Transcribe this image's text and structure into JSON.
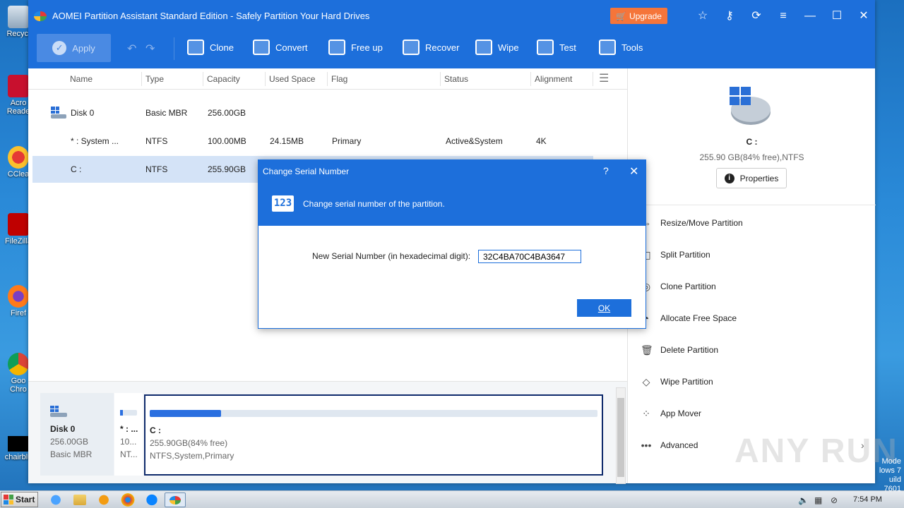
{
  "desktop": {
    "icons": [
      {
        "label": "Recycl"
      },
      {
        "label": "Acro Reade"
      },
      {
        "label": "CClea"
      },
      {
        "label": "FileZilla"
      },
      {
        "label": "Firef"
      },
      {
        "label": "Goo Chro"
      },
      {
        "label": "chairblu"
      }
    ],
    "win_mode": [
      "Mode",
      "lows 7",
      "uild 7601"
    ]
  },
  "app": {
    "title": "AOMEI Partition Assistant Standard Edition - Safely Partition Your Hard Drives",
    "upgrade_label": "Upgrade",
    "apply_label": "Apply",
    "tools": [
      {
        "label": "Clone"
      },
      {
        "label": "Convert"
      },
      {
        "label": "Free up"
      },
      {
        "label": "Recover"
      },
      {
        "label": "Wipe"
      },
      {
        "label": "Test"
      },
      {
        "label": "Tools"
      }
    ]
  },
  "table": {
    "columns": [
      "Name",
      "Type",
      "Capacity",
      "Used Space",
      "Flag",
      "Status",
      "Alignment"
    ],
    "rows": [
      {
        "name": "Disk 0",
        "type": "Basic MBR",
        "capacity": "256.00GB",
        "used": "",
        "flag": "",
        "status": "",
        "alignment": ""
      },
      {
        "name": "* : System ...",
        "type": "NTFS",
        "capacity": "100.00MB",
        "used": "24.15MB",
        "flag": "Primary",
        "status": "Active&System",
        "alignment": "4K"
      },
      {
        "name": "C :",
        "type": "NTFS",
        "capacity": "255.90GB",
        "used": "",
        "flag": "",
        "status": "",
        "alignment": ""
      }
    ]
  },
  "diskmap": {
    "disk_name": "Disk 0",
    "disk_size": "256.00GB",
    "disk_type": "Basic MBR",
    "small_name": "* : ...",
    "small_size": "10...",
    "small_fs": "NT...",
    "main_name": "C :",
    "main_size": "255.90GB(84% free)",
    "main_info": "NTFS,System,Primary",
    "main_used_fraction": 0.16
  },
  "rpanel": {
    "drive": "C :",
    "info": "255.90 GB(84% free),NTFS",
    "properties_label": "Properties",
    "operations": [
      {
        "label": "Resize/Move Partition",
        "icon": "resize-icon"
      },
      {
        "label": "Split Partition",
        "icon": "split-icon"
      },
      {
        "label": "Clone Partition",
        "icon": "clone-icon"
      },
      {
        "label": "Allocate Free Space",
        "icon": "allocate-icon"
      },
      {
        "label": "Delete Partition",
        "icon": "trash-icon"
      },
      {
        "label": "Wipe Partition",
        "icon": "eraser-icon"
      },
      {
        "label": "App Mover",
        "icon": "apps-icon"
      },
      {
        "label": "Advanced",
        "icon": "more-icon"
      }
    ]
  },
  "dialog": {
    "title": "Change Serial Number",
    "help": "?",
    "subtitle": "Change serial number of the partition.",
    "icon_text": "123",
    "field_label": "New Serial Number (in hexadecimal digit):",
    "field_value": "32C4BA70C4BA3647",
    "ok_label": "OK"
  },
  "taskbar": {
    "start_label": "Start",
    "clock": "7:54 PM"
  },
  "watermark": "ANY RUN",
  "colors": {
    "accent": "#1d6fdb",
    "upgrade": "#f5753a",
    "selected_row": "#d4e3f7"
  }
}
